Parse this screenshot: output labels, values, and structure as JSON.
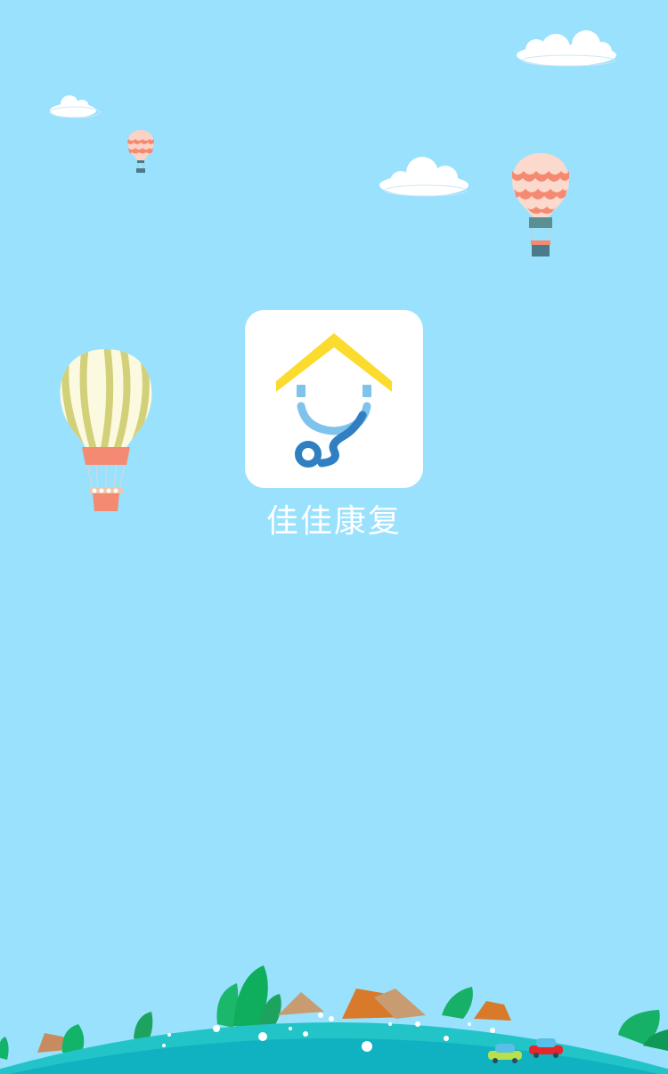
{
  "app": {
    "name": "佳佳康复",
    "icon": "house-stethoscope-logo"
  },
  "colors": {
    "sky": "#99e1fd",
    "roof": "#fbdc2e",
    "stethoscope_light": "#7ec3eb",
    "stethoscope_dark": "#2f7fc2",
    "globe": "#1fc3c9",
    "globe_inner": "#14b0c0"
  },
  "decorations": {
    "clouds": [
      "cloud",
      "cloud",
      "cloud"
    ],
    "balloons": [
      "striped-balloon",
      "scalloped-balloon-large",
      "scalloped-balloon-small"
    ]
  }
}
